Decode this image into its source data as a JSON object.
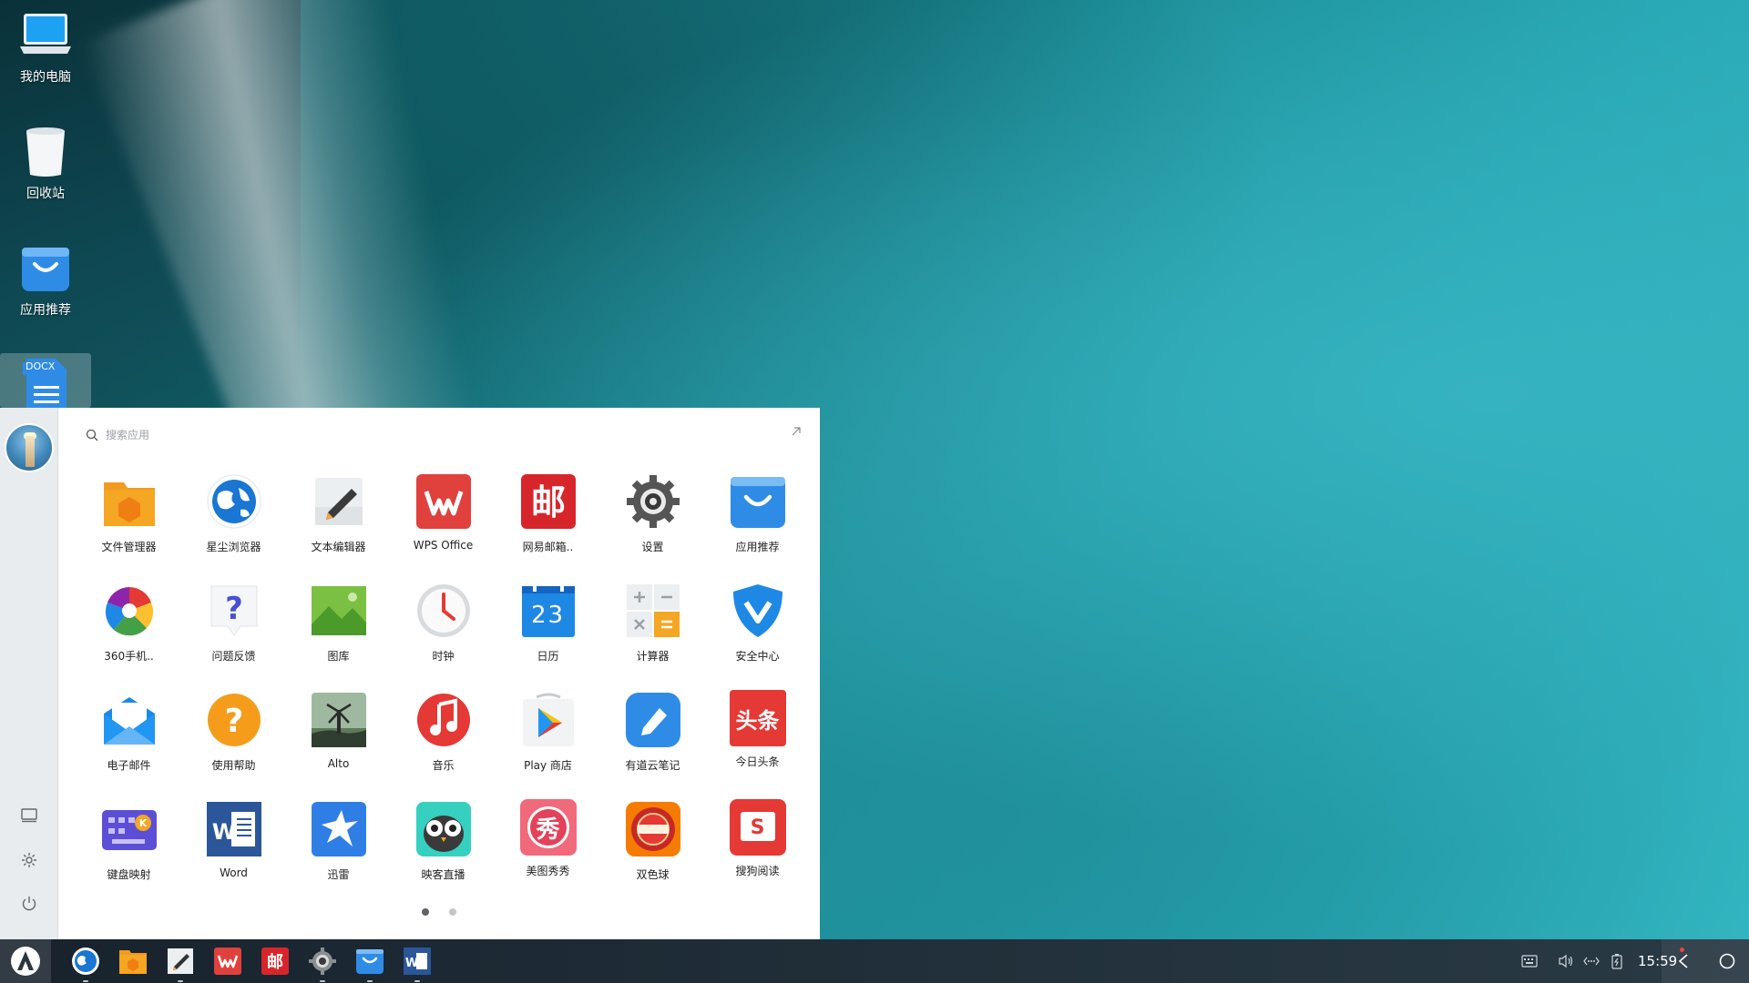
{
  "desktop": {
    "icons": [
      {
        "label": "我的电脑",
        "icon": "computer-icon"
      },
      {
        "label": "回收站",
        "icon": "trash-icon"
      },
      {
        "label": "应用推荐",
        "icon": "app-store-icon"
      },
      {
        "label": "",
        "badge": "DOCX",
        "icon": "docx-file-icon"
      }
    ]
  },
  "start_menu": {
    "search_placeholder": "搜索应用",
    "apps": [
      {
        "label": "文件管理器",
        "icon": "file-manager-icon"
      },
      {
        "label": "星尘浏览器",
        "icon": "browser-icon"
      },
      {
        "label": "文本编辑器",
        "icon": "text-editor-icon"
      },
      {
        "label": "WPS Office",
        "icon": "wps-icon"
      },
      {
        "label": "网易邮箱..",
        "icon": "netease-mail-icon"
      },
      {
        "label": "设置",
        "icon": "settings-gear-icon"
      },
      {
        "label": "应用推荐",
        "icon": "app-store-icon"
      },
      {
        "label": "360手机..",
        "icon": "360-icon"
      },
      {
        "label": "问题反馈",
        "icon": "feedback-icon"
      },
      {
        "label": "图库",
        "icon": "gallery-icon"
      },
      {
        "label": "时钟",
        "icon": "clock-icon"
      },
      {
        "label": "日历",
        "icon": "calendar-icon",
        "day": "23"
      },
      {
        "label": "计算器",
        "icon": "calculator-icon"
      },
      {
        "label": "安全中心",
        "icon": "security-shield-icon"
      },
      {
        "label": "电子邮件",
        "icon": "email-icon"
      },
      {
        "label": "使用帮助",
        "icon": "help-icon"
      },
      {
        "label": "Alto",
        "icon": "alto-game-icon"
      },
      {
        "label": "音乐",
        "icon": "music-icon"
      },
      {
        "label": "Play 商店",
        "icon": "play-store-icon"
      },
      {
        "label": "有道云笔记",
        "icon": "youdao-note-icon"
      },
      {
        "label": "今日头条",
        "icon": "toutiao-icon",
        "glyph": "头条"
      },
      {
        "label": "键盘映射",
        "icon": "keyboard-mapping-icon"
      },
      {
        "label": "Word",
        "icon": "word-icon"
      },
      {
        "label": "迅雷",
        "icon": "xunlei-icon"
      },
      {
        "label": "映客直播",
        "icon": "inke-owl-icon"
      },
      {
        "label": "美图秀秀",
        "icon": "meitu-icon",
        "glyph": "秀"
      },
      {
        "label": "双色球",
        "icon": "lottery-icon"
      },
      {
        "label": "搜狗阅读",
        "icon": "sogou-reader-icon",
        "glyph": "S"
      }
    ],
    "pages": 2,
    "current_page": 1
  },
  "taskbar": {
    "pinned": [
      {
        "icon": "browser-icon"
      },
      {
        "icon": "file-manager-icon"
      },
      {
        "icon": "text-editor-icon"
      },
      {
        "icon": "wps-icon"
      },
      {
        "icon": "netease-mail-icon"
      },
      {
        "icon": "settings-gear-icon"
      },
      {
        "icon": "app-store-icon"
      },
      {
        "icon": "word-icon"
      }
    ],
    "clock": "15:59"
  },
  "colors": {
    "wps_red": "#e0413c",
    "mail_red": "#d7262b",
    "blue": "#2f8ce6",
    "orange": "#f5a623"
  }
}
